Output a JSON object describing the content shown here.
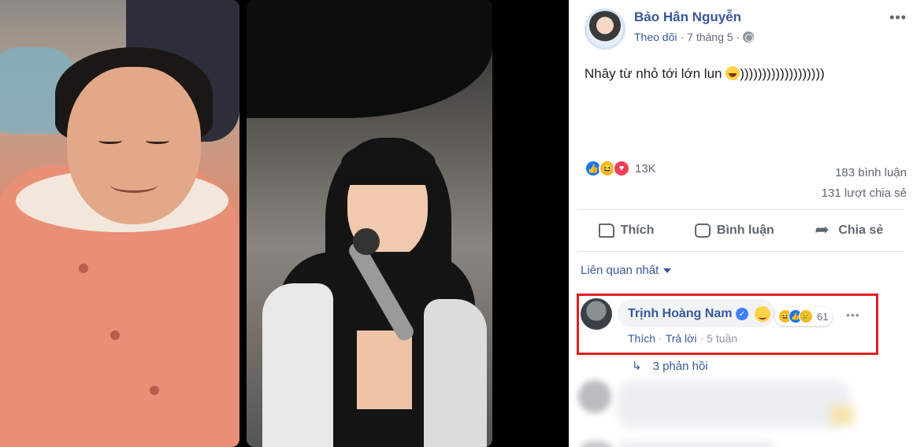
{
  "post": {
    "author": "Bảo Hân Nguyễn",
    "follow": "Theo dõi",
    "separator": "·",
    "date": "7 tháng 5",
    "more": "•••",
    "text": "Nhây từ nhỏ tới lớn lun",
    "text_suffix": ")))))))))))))))))))",
    "reaction_count": "13K",
    "comments_count": "183 bình luận",
    "shares_count": "131 lượt chia sẻ"
  },
  "actions": {
    "like": "Thích",
    "comment": "Bình luận",
    "share": "Chia sẻ"
  },
  "comments": {
    "sort_label": "Liên quan nhất",
    "top": {
      "name": "Trịnh Hoàng Nam",
      "reaction_count": "61",
      "like": "Thích",
      "reply": "Trả lời",
      "time": "5 tuần",
      "dot": "·"
    },
    "replies": "3 phản hồi"
  },
  "icons": {
    "verified": "✓",
    "reply_arrow": "↳"
  },
  "colors": {
    "link": "#385898",
    "highlight_border": "#e02020",
    "like_blue": "#1877f2",
    "love_red": "#f33e58"
  }
}
